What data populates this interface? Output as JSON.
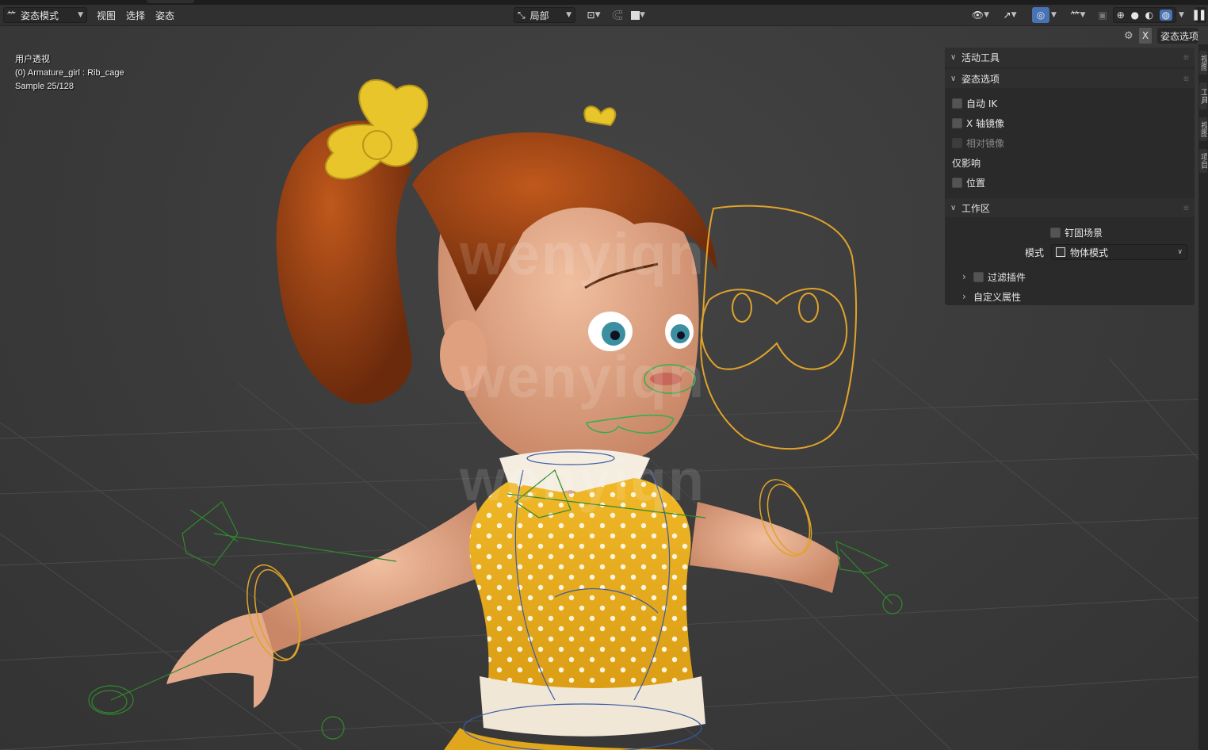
{
  "header": {
    "mode_label": "姿态模式",
    "menus": [
      "视图",
      "选择",
      "姿态"
    ],
    "pivot_label": "局部",
    "pose_options_label": "姿态选项",
    "x_mirror_label": "X"
  },
  "viewport": {
    "view_name": "用户透视",
    "active_object": "(0) Armature_girl : Rib_cage",
    "samples": "Sample 25/128",
    "watermark_text": "wenyiqn"
  },
  "sidebar": {
    "active_tool": {
      "title": "活动工具"
    },
    "pose_options": {
      "title": "姿态选项",
      "auto_ik": "自动 IK",
      "x_mirror": "X 轴镜像",
      "relative_mirror": "相对镜像",
      "affect_only": "仅影响",
      "locations": "位置"
    },
    "workspace": {
      "title": "工作区",
      "pin_scene": "钉固场景",
      "mode_label": "模式",
      "mode_value": "物体模式",
      "filter_addons": "过滤插件",
      "custom_props": "自定义属性"
    }
  },
  "edge_tabs": [
    "视图",
    "工具",
    "视图",
    "项目"
  ],
  "colors": {
    "accent": "#4772b3",
    "bone_yellow": "#e0a32a",
    "bone_green": "#2e8a2e",
    "dress_yellow": "#e8b020",
    "hair": "#a04412",
    "skin": "#e0a98a"
  }
}
